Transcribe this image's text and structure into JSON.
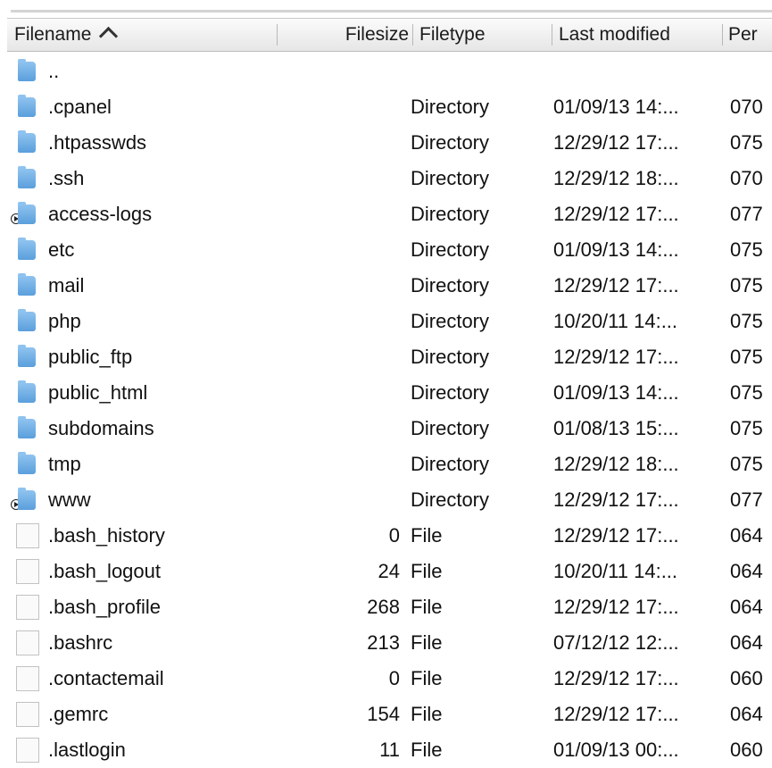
{
  "columns": {
    "filename": "Filename",
    "filesize": "Filesize",
    "filetype": "Filetype",
    "last_modified": "Last modified",
    "permissions": "Per"
  },
  "rows": [
    {
      "name": "..",
      "size": "",
      "type": "",
      "modified": "",
      "perm": "",
      "kind": "folder",
      "disclosure": false
    },
    {
      "name": ".cpanel",
      "size": "",
      "type": "Directory",
      "modified": "01/09/13 14:...",
      "perm": "070",
      "kind": "folder",
      "disclosure": false
    },
    {
      "name": ".htpasswds",
      "size": "",
      "type": "Directory",
      "modified": "12/29/12 17:...",
      "perm": "075",
      "kind": "folder",
      "disclosure": false
    },
    {
      "name": ".ssh",
      "size": "",
      "type": "Directory",
      "modified": "12/29/12 18:...",
      "perm": "070",
      "kind": "folder",
      "disclosure": false
    },
    {
      "name": "access-logs",
      "size": "",
      "type": "Directory",
      "modified": "12/29/12 17:...",
      "perm": "077",
      "kind": "folder",
      "disclosure": true
    },
    {
      "name": "etc",
      "size": "",
      "type": "Directory",
      "modified": "01/09/13 14:...",
      "perm": "075",
      "kind": "folder",
      "disclosure": false
    },
    {
      "name": "mail",
      "size": "",
      "type": "Directory",
      "modified": "12/29/12 17:...",
      "perm": "075",
      "kind": "folder",
      "disclosure": false
    },
    {
      "name": "php",
      "size": "",
      "type": "Directory",
      "modified": "10/20/11 14:...",
      "perm": "075",
      "kind": "folder",
      "disclosure": false
    },
    {
      "name": "public_ftp",
      "size": "",
      "type": "Directory",
      "modified": "12/29/12 17:...",
      "perm": "075",
      "kind": "folder",
      "disclosure": false
    },
    {
      "name": "public_html",
      "size": "",
      "type": "Directory",
      "modified": "01/09/13 14:...",
      "perm": "075",
      "kind": "folder",
      "disclosure": false
    },
    {
      "name": "subdomains",
      "size": "",
      "type": "Directory",
      "modified": "01/08/13 15:...",
      "perm": "075",
      "kind": "folder",
      "disclosure": false
    },
    {
      "name": "tmp",
      "size": "",
      "type": "Directory",
      "modified": "12/29/12 18:...",
      "perm": "075",
      "kind": "folder",
      "disclosure": false
    },
    {
      "name": "www",
      "size": "",
      "type": "Directory",
      "modified": "12/29/12 17:...",
      "perm": "077",
      "kind": "folder",
      "disclosure": true
    },
    {
      "name": ".bash_history",
      "size": "0",
      "type": "File",
      "modified": "12/29/12 17:...",
      "perm": "064",
      "kind": "file",
      "disclosure": false
    },
    {
      "name": ".bash_logout",
      "size": "24",
      "type": "File",
      "modified": "10/20/11 14:...",
      "perm": "064",
      "kind": "file",
      "disclosure": false
    },
    {
      "name": ".bash_profile",
      "size": "268",
      "type": "File",
      "modified": "12/29/12 17:...",
      "perm": "064",
      "kind": "file",
      "disclosure": false
    },
    {
      "name": ".bashrc",
      "size": "213",
      "type": "File",
      "modified": "07/12/12 12:...",
      "perm": "064",
      "kind": "file",
      "disclosure": false
    },
    {
      "name": ".contactemail",
      "size": "0",
      "type": "File",
      "modified": "12/29/12 17:...",
      "perm": "060",
      "kind": "file",
      "disclosure": false
    },
    {
      "name": ".gemrc",
      "size": "154",
      "type": "File",
      "modified": "12/29/12 17:...",
      "perm": "064",
      "kind": "file",
      "disclosure": false
    },
    {
      "name": ".lastlogin",
      "size": "11",
      "type": "File",
      "modified": "01/09/13 00:...",
      "perm": "060",
      "kind": "file",
      "disclosure": false
    }
  ],
  "colors": {
    "folder": "#5a9fdc",
    "header_bg": "#e6e6e6"
  }
}
